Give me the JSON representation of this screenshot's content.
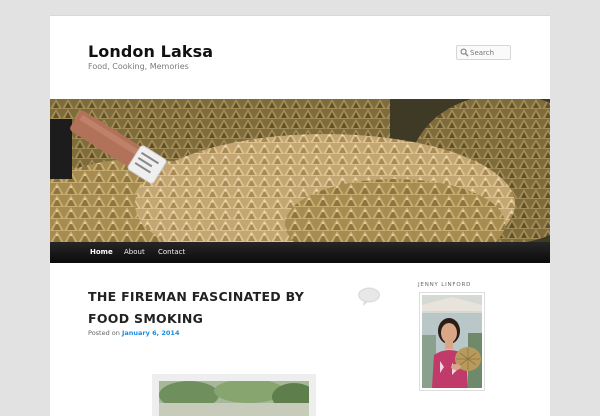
{
  "site": {
    "title": "London Laksa",
    "description": "Food, Cooking, Memories"
  },
  "search": {
    "placeholder": "Search",
    "icon": "search-icon"
  },
  "nav": {
    "items": [
      {
        "label": "Home",
        "active": true
      },
      {
        "label": "About",
        "active": false
      },
      {
        "label": "Contact",
        "active": false
      }
    ]
  },
  "post": {
    "title": "THE FIREMAN FASCINATED BY FOOD SMOKING",
    "posted_prefix": "Posted on",
    "date": "January 6, 2014",
    "comment_icon": "comment-bubble-icon"
  },
  "sidebar": {
    "widget_title": "Jenny Linford"
  },
  "colors": {
    "page_background": "#e2e2e2",
    "nav_background": "#1a1a1a",
    "link": "#1b8be0"
  }
}
